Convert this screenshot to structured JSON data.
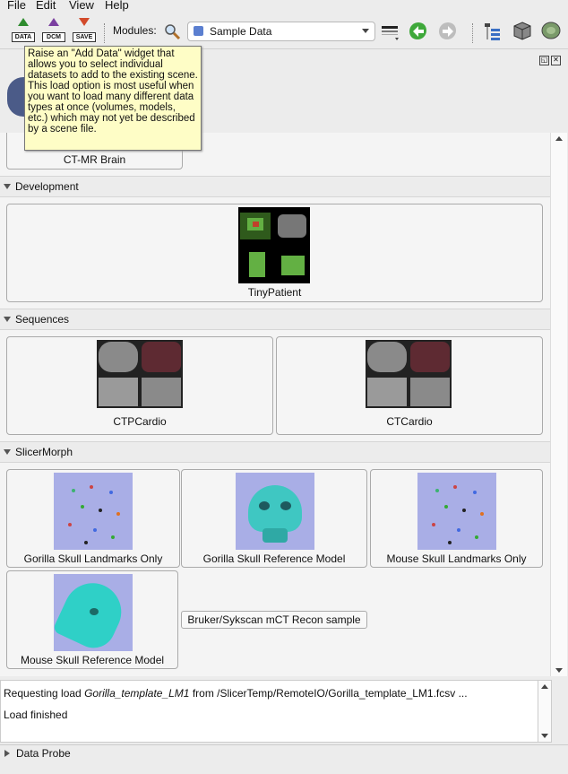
{
  "menu": {
    "file": "File",
    "edit": "Edit",
    "view": "View",
    "help": "Help"
  },
  "toolbar": {
    "data_label": "DATA",
    "dcm_label": "DCM",
    "save_label": "SAVE",
    "modules_label": "Modules:",
    "module_selected": "Sample Data"
  },
  "tooltip": {
    "text": "Raise an \"Add Data\" widget that allows you to select individual datasets to add to the existing scene. This load option is most useful when you want to load many different data types at once (volumes, models, etc.) which may not yet be described by a scene file."
  },
  "sections": {
    "partial_item": "CT-MR Brain",
    "development": {
      "title": "Development",
      "items": [
        "TinyPatient"
      ]
    },
    "sequences": {
      "title": "Sequences",
      "items": [
        "CTPCardio",
        "CTCardio"
      ]
    },
    "slicermorph": {
      "title": "SlicerMorph",
      "items": [
        "Gorilla Skull Landmarks Only",
        "Gorilla Skull Reference Model",
        "Mouse Skull Landmarks Only",
        "Mouse Skull Reference Model",
        "Bruker/Sykscan mCT Recon sample"
      ]
    }
  },
  "status": {
    "line1_prefix": "Requesting load ",
    "line1_name": "Gorilla_template_LM1",
    "line1_suffix": " from /SlicerTemp/RemoteIO/Gorilla_template_LM1.fcsv ...",
    "line2": "Load finished"
  },
  "data_probe": "Data Probe"
}
